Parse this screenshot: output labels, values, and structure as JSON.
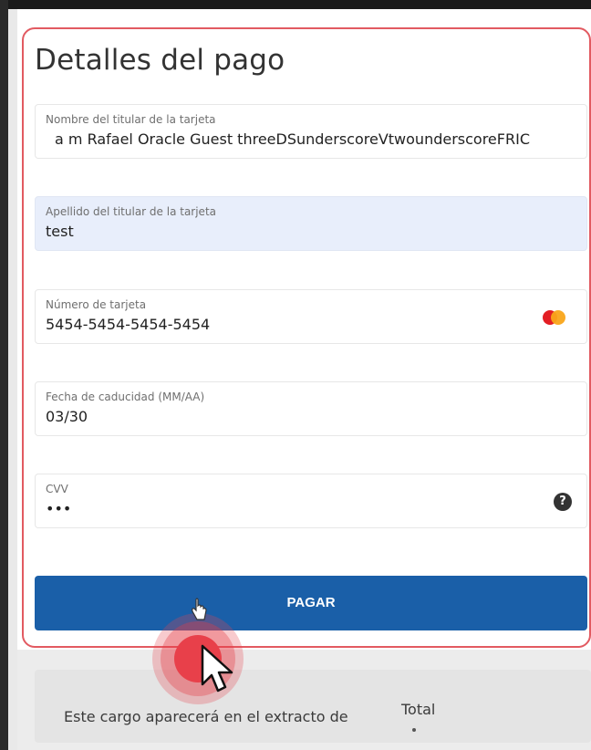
{
  "payment": {
    "title": "Detalles del pago",
    "fields": [
      {
        "label": "Nombre del titular de la tarjeta",
        "value": "a m Rafael Oracle Guest threeDSunderscoreVtwounderscoreFRIC"
      },
      {
        "label": "Apellido del titular de la tarjeta",
        "value": "test"
      },
      {
        "label": "Número de tarjeta",
        "value": "5454-5454-5454-5454",
        "icon": "mastercard-icon"
      },
      {
        "label": "Fecha de caducidad (MM/AA)",
        "value": "03/30"
      },
      {
        "label": "CVV",
        "value": "•••",
        "icon": "help-icon",
        "help_glyph": "?"
      }
    ],
    "pay_label": "PAGAR"
  },
  "notice": {
    "text": "Este cargo aparecerá en el extracto de",
    "total_label": "Total"
  },
  "colors": {
    "accent_border": "#e25a61",
    "button": "#1a5fa8",
    "active_field": "#e8eefb",
    "click_indicator": "#e8404a"
  }
}
